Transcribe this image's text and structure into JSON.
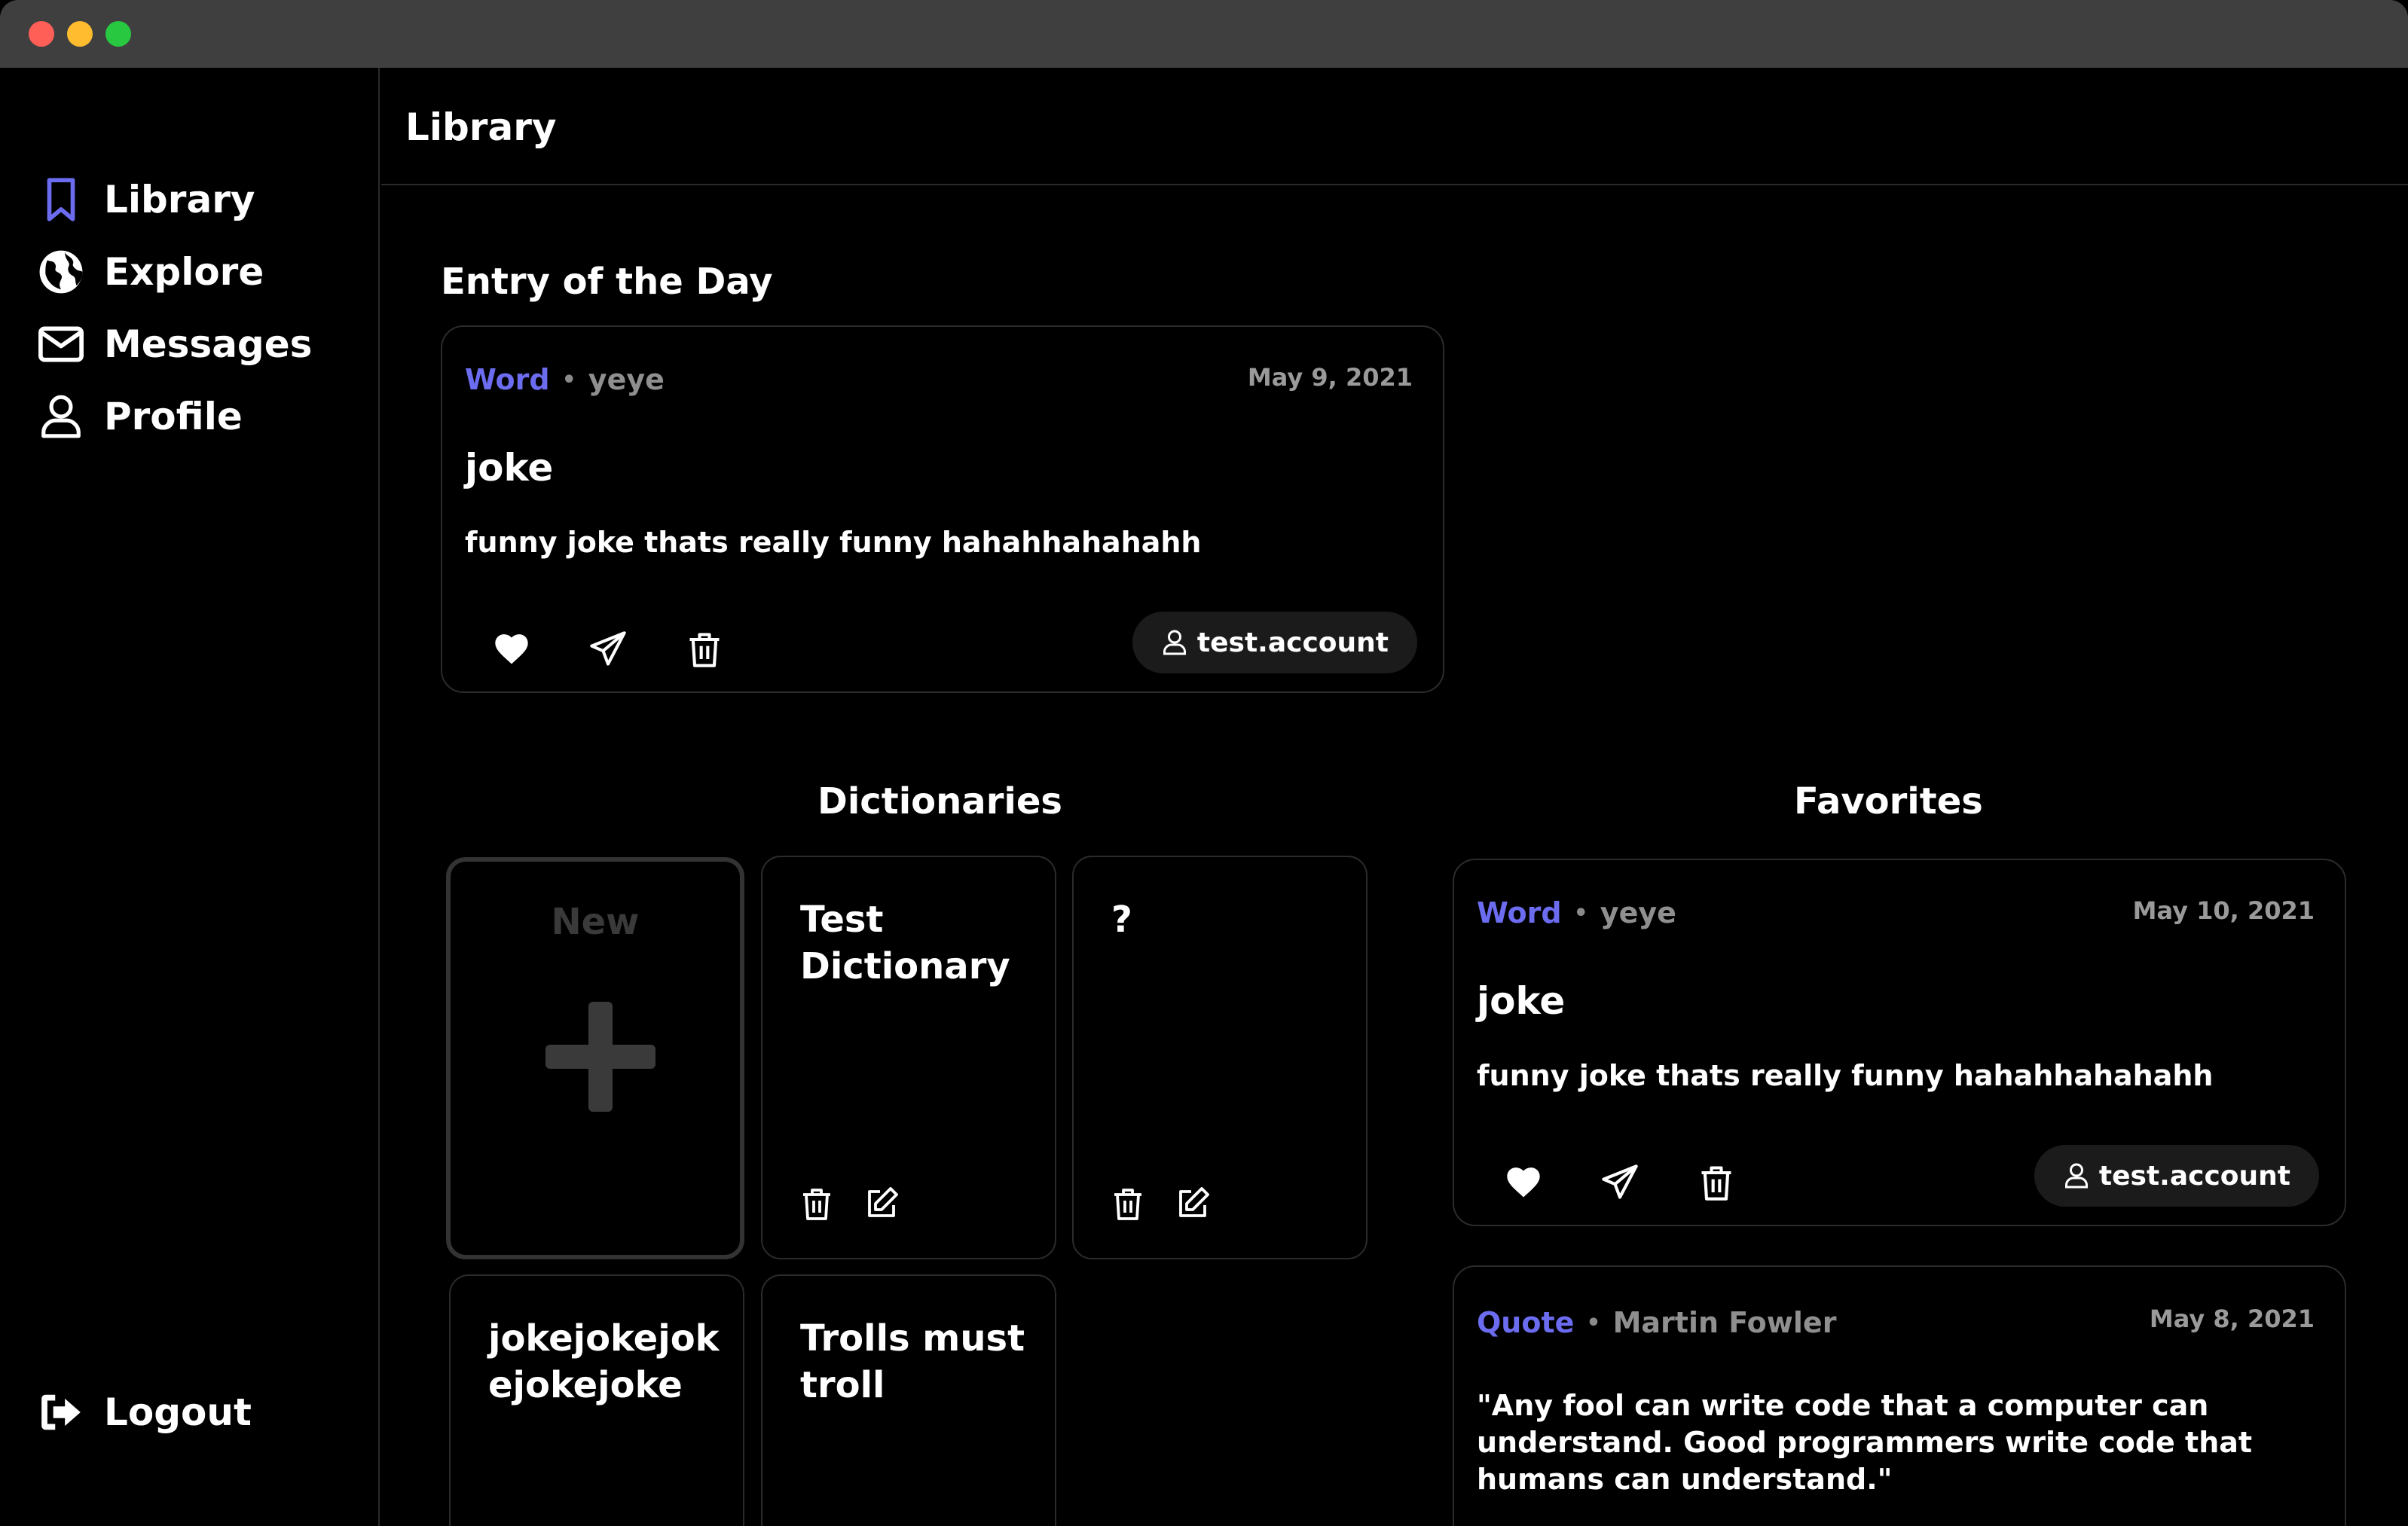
{
  "sidebar": {
    "items": [
      {
        "label": "Library",
        "icon": "bookmark-icon",
        "active": true
      },
      {
        "label": "Explore",
        "icon": "globe-icon"
      },
      {
        "label": "Messages",
        "icon": "envelope-icon"
      },
      {
        "label": "Profile",
        "icon": "user-icon"
      }
    ],
    "logout": {
      "label": "Logout",
      "icon": "sign-out-icon"
    }
  },
  "header": {
    "title": "Library"
  },
  "entry_of_day": {
    "section_title": "Entry of the Day",
    "type": "Word",
    "author": "yeye",
    "date": "May 9, 2021",
    "term": "joke",
    "definition": "funny joke thats really funny hahahhahahahh",
    "user": "test.account"
  },
  "dictionaries": {
    "section_title": "Dictionaries",
    "new_label": "New",
    "items": [
      {
        "title": "Test Dictionary"
      },
      {
        "title": "?"
      },
      {
        "title": "jokejokejok ejokejoke"
      },
      {
        "title": "Trolls must troll"
      }
    ]
  },
  "favorites": {
    "section_title": "Favorites",
    "items": [
      {
        "type": "Word",
        "author": "yeye",
        "date": "May 10, 2021",
        "term": "joke",
        "definition": "funny joke thats really funny hahahhahahahh",
        "user": "test.account"
      },
      {
        "type": "Quote",
        "author": "Martin Fowler",
        "date": "May 8, 2021",
        "text": "\"Any fool can write code that a computer can understand. Good programmers write code that humans can understand.\""
      }
    ]
  },
  "colors": {
    "accent": "#6c6cf0",
    "background": "#000000",
    "border": "#2b2b2b"
  }
}
